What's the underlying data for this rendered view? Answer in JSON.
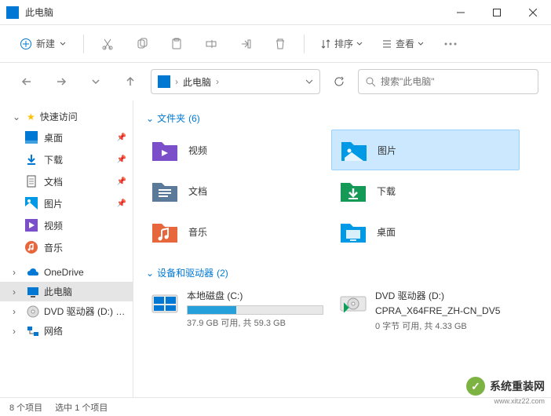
{
  "window": {
    "title": "此电脑"
  },
  "toolbar": {
    "new_label": "新建",
    "sort_label": "排序",
    "view_label": "查看"
  },
  "address": {
    "location": "此电脑"
  },
  "search": {
    "placeholder": "搜索\"此电脑\""
  },
  "sidebar": {
    "quick_access": "快速访问",
    "items": [
      {
        "label": "桌面",
        "pinned": true
      },
      {
        "label": "下载",
        "pinned": true
      },
      {
        "label": "文档",
        "pinned": true
      },
      {
        "label": "图片",
        "pinned": true
      },
      {
        "label": "视频",
        "pinned": false
      },
      {
        "label": "音乐",
        "pinned": false
      }
    ],
    "onedrive": "OneDrive",
    "this_pc": "此电脑",
    "dvd": "DVD 驱动器 (D:) CP",
    "network": "网络"
  },
  "sections": {
    "folders": {
      "label": "文件夹",
      "count": "(6)"
    },
    "devices": {
      "label": "设备和驱动器",
      "count": "(2)"
    }
  },
  "folders": [
    {
      "label": "视频"
    },
    {
      "label": "图片"
    },
    {
      "label": "文档"
    },
    {
      "label": "下载"
    },
    {
      "label": "音乐"
    },
    {
      "label": "桌面"
    }
  ],
  "drives": [
    {
      "name": "本地磁盘 (C:)",
      "subtitle": "37.9 GB 可用, 共 59.3 GB",
      "fill_pct": 36
    },
    {
      "name": "DVD 驱动器 (D:)",
      "name2": "CPRA_X64FRE_ZH-CN_DV5",
      "subtitle": "0 字节 可用, 共 4.33 GB"
    }
  ],
  "status": {
    "count": "8 个项目",
    "selected": "选中 1 个项目"
  },
  "watermark": {
    "text": "系统重装网",
    "url": "www.xitz22.com"
  }
}
